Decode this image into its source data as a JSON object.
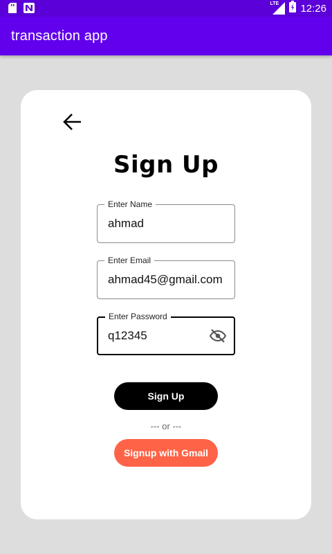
{
  "status_bar": {
    "time": "12:26",
    "network_label": "LTE",
    "icons": [
      "sd-card-icon",
      "n-notification-icon",
      "signal-icon",
      "battery-icon"
    ]
  },
  "app_bar": {
    "title": "transaction app"
  },
  "form": {
    "title": "Sign Up",
    "name": {
      "label": "Enter Name",
      "value": "ahmad"
    },
    "email": {
      "label": "Enter Email",
      "value": "ahmad45@gmail.com"
    },
    "password": {
      "label": "Enter Password",
      "value": "q12345"
    },
    "signup_button": "Sign Up",
    "divider": "--- or ---",
    "gmail_button": "Signup with Gmail"
  },
  "colors": {
    "status_bar": "#5b00d9",
    "app_bar": "#6200ee",
    "background": "#dddddd",
    "signup_button": "#000000",
    "gmail_button": "#ff6347"
  }
}
